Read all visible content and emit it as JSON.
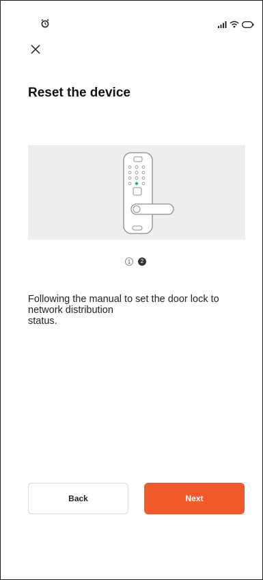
{
  "status_bar": {
    "left_icon": "alarm-clock-icon",
    "right_icons": [
      "signal-icon",
      "wifi-icon",
      "battery-icon"
    ]
  },
  "header": {
    "close_icon": "close-icon",
    "title": "Reset the device"
  },
  "illustration": {
    "subject": "door-lock-icon",
    "indicator_color": "#16b36e"
  },
  "pager": {
    "pages": [
      "1",
      "2"
    ],
    "current": 2
  },
  "instructions": {
    "line1": "Following the manual to set the door lock to",
    "line2": "network distribution",
    "line3": "status."
  },
  "footer": {
    "back_label": "Back",
    "next_label": "Next"
  },
  "colors": {
    "accent": "#f15a2b",
    "illustration_bg": "#eeeeee"
  }
}
